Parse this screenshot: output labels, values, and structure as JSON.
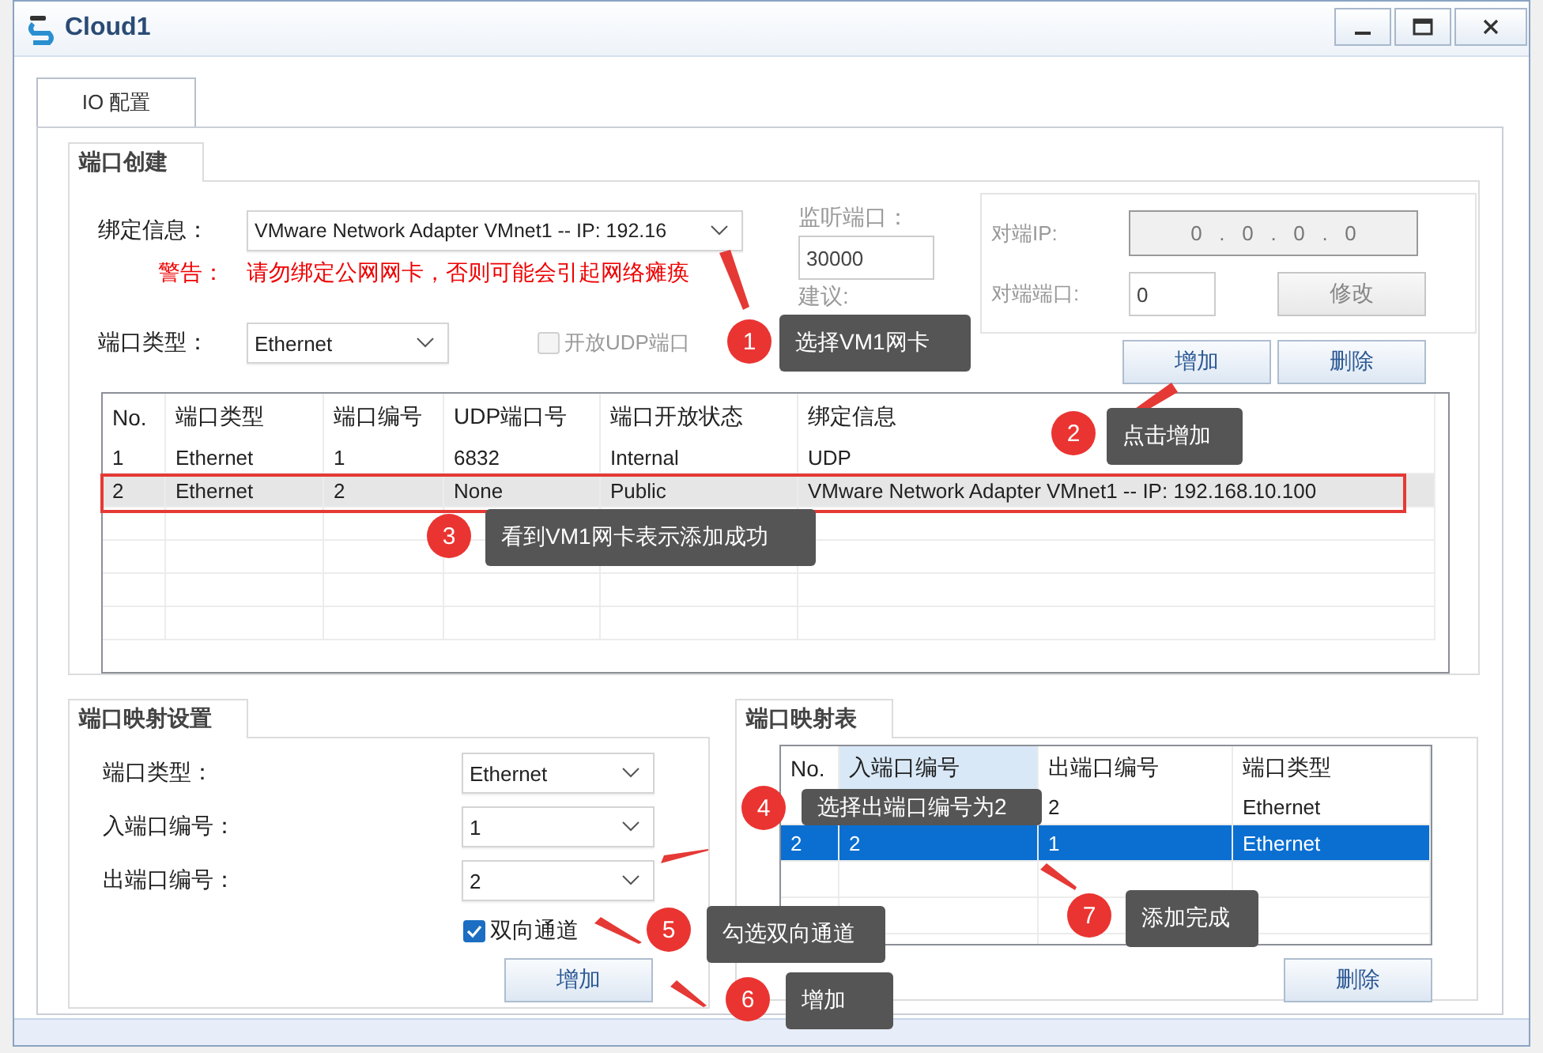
{
  "window": {
    "title": "Cloud1"
  },
  "tabs": [
    {
      "label": "IO 配置",
      "selected": true
    }
  ],
  "port_create": {
    "title": "端口创建",
    "binding_label": "绑定信息：",
    "binding_value": "VMware Network Adapter VMnet1 -- IP: 192.16",
    "warning_label": "警告：",
    "warning_text": "请勿绑定公网网卡，否则可能会引起网络瘫痪",
    "port_type_label": "端口类型：",
    "port_type_value": "Ethernet",
    "udp_checkbox": {
      "label": "开放UDP端口",
      "checked": false,
      "disabled": true
    },
    "listen_label": "监听端口：",
    "listen_value": "30000",
    "suggest_label": "建议:",
    "peer": {
      "disabled": true,
      "ip_label": "对端IP:",
      "ip_value": "0   .   0   .   0   .   0",
      "port_label": "对端端口:",
      "port_value": "0",
      "modify_button": "修改"
    },
    "add_button": "增加",
    "delete_button": "删除",
    "table": {
      "columns": [
        "No.",
        "端口类型",
        "端口编号",
        "UDP端口号",
        "端口开放状态",
        "绑定信息"
      ],
      "rows": [
        {
          "cells": [
            "1",
            "Ethernet",
            "1",
            "6832",
            "Internal",
            "UDP"
          ],
          "selected": false
        },
        {
          "cells": [
            "2",
            "Ethernet",
            "2",
            "None",
            "Public",
            "VMware Network Adapter VMnet1 -- IP: 192.168.10.100"
          ],
          "selected": true
        }
      ]
    }
  },
  "port_map_settings": {
    "title": "端口映射设置",
    "fields": [
      {
        "label": "端口类型：",
        "value": "Ethernet"
      },
      {
        "label": "入端口编号：",
        "value": "1"
      },
      {
        "label": "出端口编号：",
        "value": "2"
      }
    ],
    "bidirectional": {
      "label": "双向通道",
      "checked": true
    },
    "add_button": "增加"
  },
  "port_map_table": {
    "title": "端口映射表",
    "columns": [
      {
        "label": "No.",
        "selected": false
      },
      {
        "label": "入端口编号",
        "selected": true
      },
      {
        "label": "出端口编号",
        "selected": false
      },
      {
        "label": "端口类型",
        "selected": false
      }
    ],
    "rows": [
      {
        "cells": [
          null,
          null,
          "2",
          "Ethernet"
        ],
        "selected": false
      },
      {
        "cells": [
          "2",
          "2",
          "1",
          "Ethernet"
        ],
        "selected": true
      }
    ],
    "delete_button": "删除"
  },
  "callouts": [
    {
      "number": "1",
      "text": "选择VM1网卡"
    },
    {
      "number": "2",
      "text": "点击增加"
    },
    {
      "number": "3",
      "text": "看到VM1网卡表示添加成功"
    },
    {
      "number": "4",
      "text": "选择出端口编号为2"
    },
    {
      "number": "5",
      "text": "勾选双向通道"
    },
    {
      "number": "6",
      "text": "增加"
    },
    {
      "number": "7",
      "text": "添加完成"
    }
  ]
}
